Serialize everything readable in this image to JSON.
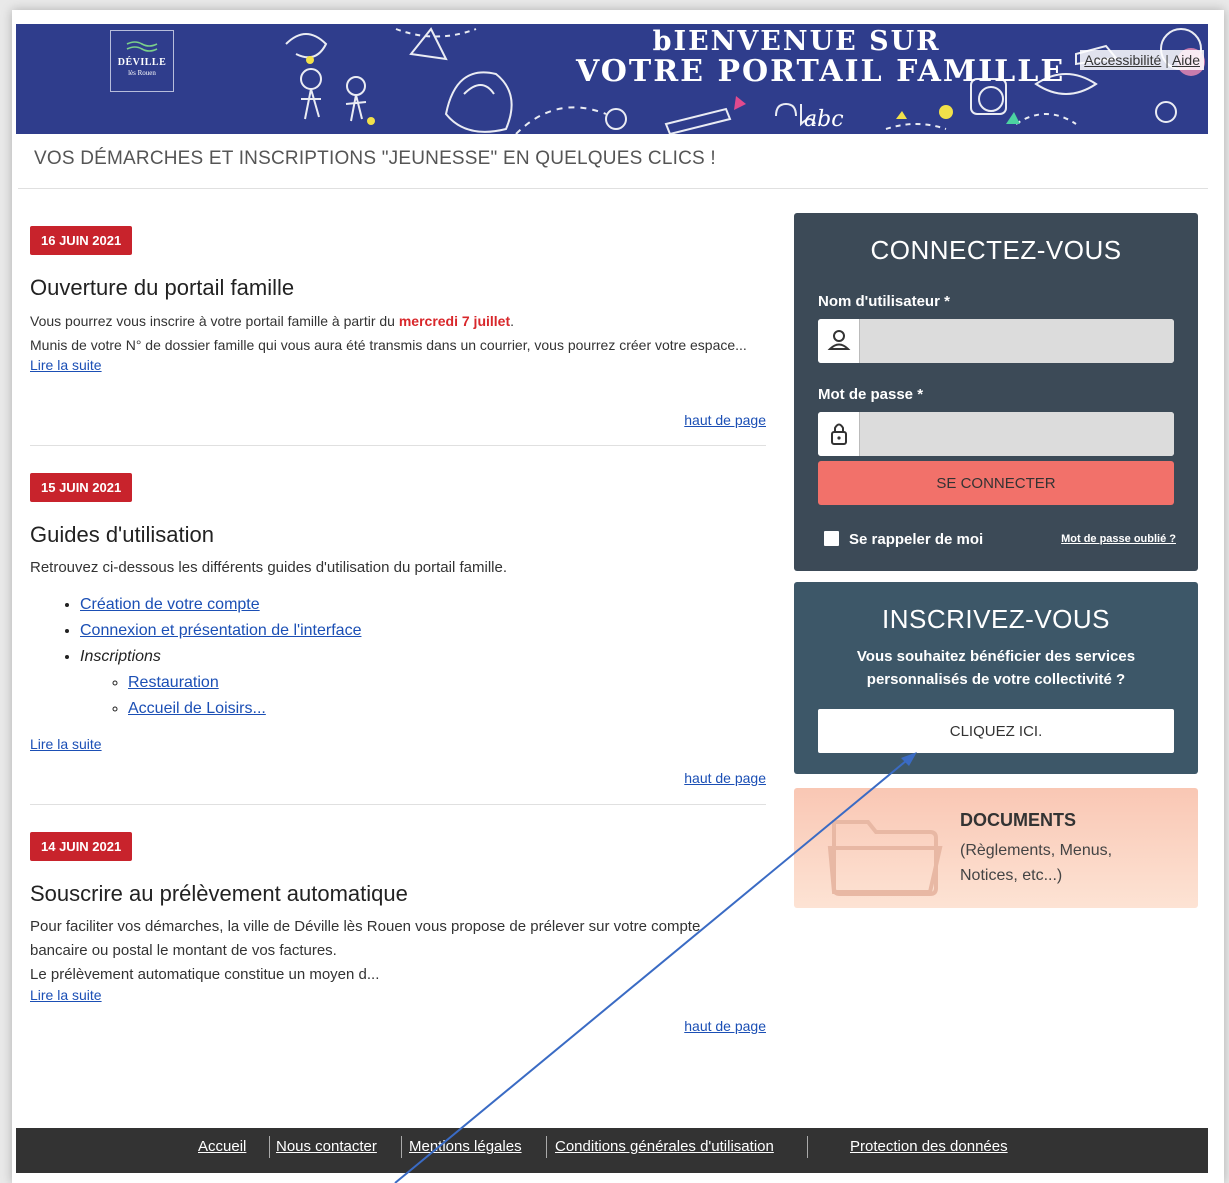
{
  "header": {
    "logo_line1": "DÉVILLE",
    "logo_line2": "lès Rouen",
    "banner_line1": "bIENVENUE SUR",
    "banner_line2": "VOTRE PORTAIL FAMILLE",
    "banner_doodle_text": "abc",
    "accessibility_link": "Accessibilité",
    "separator": "|",
    "help_link": "Aide",
    "tagline": "VOS DÉMARCHES ET INSCRIPTIONS \"JEUNESSE\" EN QUELQUES CLICS !"
  },
  "news": [
    {
      "date": "16 JUIN 2021",
      "title": "Ouverture du portail famille",
      "text1_before": "Vous pourrez vous inscrire à votre portail famille à partir du ",
      "text1_highlight": "mercredi 7 juillet",
      "text1_after": ".",
      "text2": "Munis de votre N° de dossier famille qui vous aura été transmis dans un courrier, vous pourrez créer votre espace...",
      "read_more": "Lire la suite",
      "top_link": "haut de page"
    },
    {
      "date": "15 JUIN 2021",
      "title": "Guides d'utilisation",
      "text1": "Retrouvez ci-dessous les différents guides d'utilisation du portail famille.",
      "guide1": "Création de votre compte",
      "guide2": "Connexion et présentation de l'interface",
      "guide3": "Inscriptions",
      "sub1": "Restauration ",
      "sub2": "Accueil de Loisirs...",
      "read_more": "Lire la suite",
      "top_link": "haut de page"
    },
    {
      "date": "14 JUIN 2021",
      "title": "Souscrire au prélèvement automatique",
      "text1": "Pour faciliter vos démarches, la ville de Déville lès Rouen vous propose de prélever sur votre compte bancaire ou postal le montant de vos factures.",
      "text2": "Le prélèvement automatique constitue un moyen d...",
      "read_more": "Lire la suite",
      "top_link": "haut de page"
    }
  ],
  "login": {
    "title": "CONNECTEZ-VOUS",
    "username_label": "Nom d'utilisateur *",
    "username_value": "",
    "password_label": "Mot de passe *",
    "password_value": "",
    "submit": "SE CONNECTER",
    "remember": "Se rappeler de moi",
    "forgot": "Mot de passe oublié ?"
  },
  "register": {
    "title": "INSCRIVEZ-VOUS",
    "text": "Vous souhaitez bénéficier des services personnalisés de votre collectivité ?",
    "button": "CLIQUEZ ICI."
  },
  "documents": {
    "title": "DOCUMENTS",
    "subtitle": "(Règlements, Menus, Notices, etc...)"
  },
  "footer": {
    "links": [
      "Accueil",
      "Nous contacter",
      "Mentions légales",
      "Conditions générales d'utilisation",
      "Protection des données"
    ]
  },
  "colors": {
    "banner": "#2f3d8c",
    "date_badge": "#c8232c",
    "login_bg": "#3c4a57",
    "login_button": "#f2716a",
    "register_bg": "#3d5768",
    "annotation_arrow": "#3a6bc4"
  }
}
